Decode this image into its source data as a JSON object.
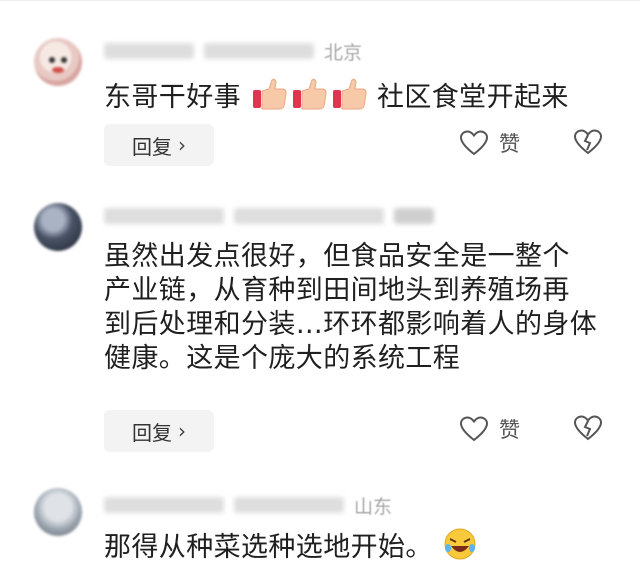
{
  "comments": [
    {
      "location": "北京",
      "text_lines": [
        "东哥干好事",
        "社区食堂开起来"
      ],
      "emoji": "thumbs-up-icon",
      "reply_label": "回复",
      "like_label": "赞"
    },
    {
      "location": "",
      "text_lines": [
        "虽然出发点很好，但食品安全是一整个",
        "产业链，从育种到田间地头到养殖场再",
        "到后处理和分装…环环都影响着人的身体",
        "健康。这是个庞大的系统工程"
      ],
      "reply_label": "回复",
      "like_label": "赞"
    },
    {
      "location": "山东",
      "text_lines": [
        "那得从种菜选种选地开始。"
      ],
      "emoji": "laughing-icon"
    }
  ],
  "colors": {
    "button_bg": "#f3f3f3",
    "text": "#1f1f1f",
    "muted": "#a7a7a7"
  }
}
